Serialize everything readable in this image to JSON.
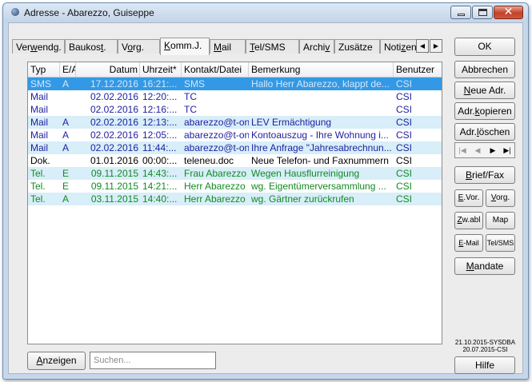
{
  "window": {
    "title": "Adresse - Abarezzo, Guiseppe"
  },
  "tabs": [
    {
      "pre": "Ver",
      "u": "w",
      "post": "endg.",
      "active": false
    },
    {
      "pre": "Baukos",
      "u": "t",
      "post": ".",
      "active": false
    },
    {
      "pre": "V",
      "u": "o",
      "post": "rg.",
      "active": false
    },
    {
      "pre": "",
      "u": "K",
      "post": "omm.J.",
      "active": true
    },
    {
      "pre": "",
      "u": "M",
      "post": "ail",
      "active": false
    },
    {
      "pre": "",
      "u": "T",
      "post": "el/SMS",
      "active": false
    },
    {
      "pre": "Archi",
      "u": "v",
      "post": "",
      "active": false
    },
    {
      "pre": "Zusätze",
      "u": "",
      "post": "",
      "active": false
    },
    {
      "pre": "Noti",
      "u": "z",
      "post": "en!",
      "active": false
    }
  ],
  "grid": {
    "columns": [
      "Typ",
      "E/A",
      "Datum",
      "Uhrzeit*",
      "Kontakt/Datei",
      "Bemerkung",
      "Benutzer"
    ],
    "rows": [
      {
        "color": "blue",
        "selected": true,
        "alt": false,
        "cells": [
          "SMS",
          "A",
          "17.12.2016",
          "16:21:...",
          "SMS",
          "Hallo Herr Abarezzo, klappt de...",
          "CSI"
        ]
      },
      {
        "color": "blue",
        "selected": false,
        "alt": false,
        "cells": [
          "Mail",
          "",
          "02.02.2016",
          "12:20:...",
          "TC",
          "",
          "CSI"
        ]
      },
      {
        "color": "blue",
        "selected": false,
        "alt": false,
        "cells": [
          "Mail",
          "",
          "02.02.2016",
          "12:16:...",
          "TC",
          "",
          "CSI"
        ]
      },
      {
        "color": "blue",
        "selected": false,
        "alt": true,
        "cells": [
          "Mail",
          "A",
          "02.02.2016",
          "12:13:...",
          "abarezzo@t-onl...",
          "LEV Ermächtigung",
          "CSI"
        ]
      },
      {
        "color": "blue",
        "selected": false,
        "alt": false,
        "cells": [
          "Mail",
          "A",
          "02.02.2016",
          "12:05:...",
          "abarezzo@t-onl...",
          "Kontoauszug - Ihre Wohnung i...",
          "CSI"
        ]
      },
      {
        "color": "blue",
        "selected": false,
        "alt": true,
        "cells": [
          "Mail",
          "A",
          "02.02.2016",
          "11:44:...",
          "abarezzo@t-onl...",
          "Ihre Anfrage \"Jahresabrechnun...",
          "CSI"
        ]
      },
      {
        "color": "black",
        "selected": false,
        "alt": false,
        "cells": [
          "Dok.",
          "",
          "01.01.2016",
          "00:00:...",
          "teleneu.doc",
          "Neue Telefon- und Faxnummern",
          "CSI"
        ]
      },
      {
        "color": "green",
        "selected": false,
        "alt": true,
        "cells": [
          "Tel.",
          "E",
          "09.11.2015",
          "14:43:...",
          "Frau Abarezzo",
          "Wegen Hausflurreinigung",
          "CSI"
        ]
      },
      {
        "color": "green",
        "selected": false,
        "alt": false,
        "cells": [
          "Tel.",
          "E",
          "09.11.2015",
          "14:21:...",
          "Herr Abarezzo",
          "wg. Eigentümerversammlung ...",
          "CSI"
        ]
      },
      {
        "color": "green",
        "selected": false,
        "alt": true,
        "cells": [
          "Tel.",
          "A",
          "03.11.2015",
          "14:40:...",
          "Herr Abarezzo",
          "wg. Gärtner zurückrufen",
          "CSI"
        ]
      }
    ]
  },
  "buttons": {
    "ok": "OK",
    "abbrechen": "Abbrechen",
    "neue_adr": {
      "pre": "",
      "u": "N",
      "post": "eue Adr."
    },
    "adr_kopieren": {
      "pre": "Adr.",
      "u": "k",
      "post": "opieren"
    },
    "adr_loeschen": {
      "pre": "Adr.",
      "u": "l",
      "post": "öschen"
    },
    "brief_fax": {
      "pre": "",
      "u": "B",
      "post": "rief/Fax"
    },
    "e_vor": {
      "pre": "",
      "u": "E",
      "post": ".Vor."
    },
    "vorg": {
      "pre": "",
      "u": "V",
      "post": "org."
    },
    "zw_abl": {
      "pre": "",
      "u": "Z",
      "post": "w.abl"
    },
    "map": "Map",
    "e_mail": {
      "pre": "",
      "u": "E",
      "post": "-Mail"
    },
    "tel_sms": "Tel/SMS",
    "mandate": {
      "pre": "",
      "u": "M",
      "post": "andate"
    },
    "hilfe": "Hilfe",
    "anzeigen": {
      "pre": "",
      "u": "A",
      "post": "nzeigen"
    }
  },
  "search": {
    "placeholder": "Suchen..."
  },
  "stamp": {
    "line1": "21.10.2015-SYSDBA",
    "line2": "20.07.2015-CSI"
  }
}
